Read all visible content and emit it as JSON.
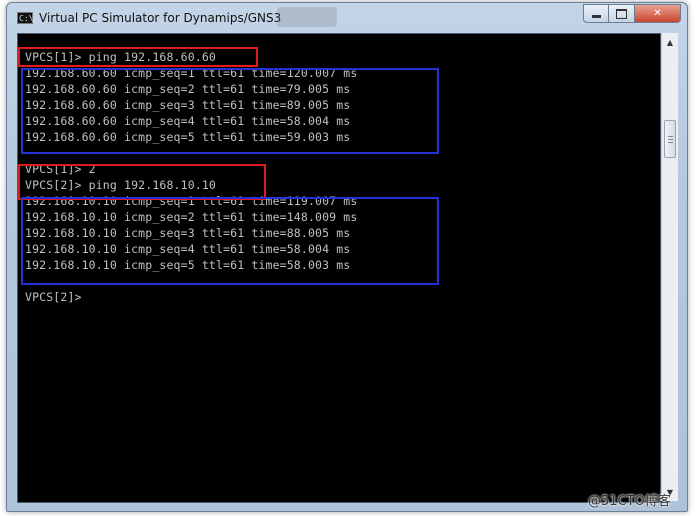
{
  "window": {
    "title": "Virtual PC Simulator for Dynamips/GNS3",
    "icon_name": "console-icon",
    "icon_glyph": "C:\\",
    "close_glyph": "✕"
  },
  "terminal": {
    "lines": [
      "VPCS[1]> ping 192.168.60.60",
      "192.168.60.60 icmp_seq=1 ttl=61 time=120.007 ms",
      "192.168.60.60 icmp_seq=2 ttl=61 time=79.005 ms",
      "192.168.60.60 icmp_seq=3 ttl=61 time=89.005 ms",
      "192.168.60.60 icmp_seq=4 ttl=61 time=58.004 ms",
      "192.168.60.60 icmp_seq=5 ttl=61 time=59.003 ms",
      "",
      "VPCS[1]> 2",
      "VPCS[2]> ping 192.168.10.10",
      "192.168.10.10 icmp_seq=1 ttl=61 time=119.007 ms",
      "192.168.10.10 icmp_seq=2 ttl=61 time=148.009 ms",
      "192.168.10.10 icmp_seq=3 ttl=61 time=88.005 ms",
      "192.168.10.10 icmp_seq=4 ttl=61 time=58.004 ms",
      "192.168.10.10 icmp_seq=5 ttl=61 time=58.003 ms",
      "",
      "VPCS[2]>"
    ],
    "text_color": "#c0c0c0",
    "background": "#000000"
  },
  "annotations": {
    "red_color": "#e01b1b",
    "blue_color": "#2430d8"
  },
  "scrollbar": {
    "up_glyph": "▲",
    "down_glyph": "▼"
  },
  "watermark": "@51CTO博客"
}
